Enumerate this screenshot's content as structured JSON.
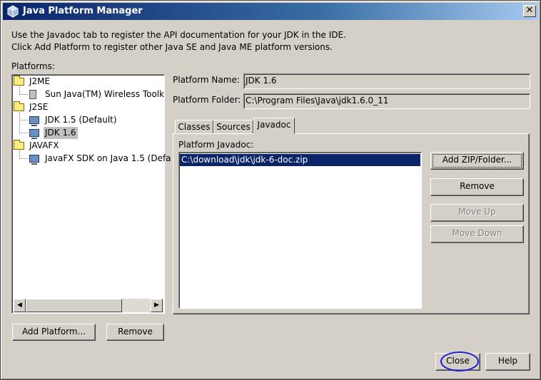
{
  "window": {
    "title": "Java Platform Manager",
    "close_glyph": "✕"
  },
  "intro": {
    "line1": "Use the Javadoc tab to register the API documentation for your JDK in the IDE.",
    "line2": "Click Add Platform to register other Java SE and Java ME platform versions."
  },
  "platforms": {
    "label": "Platforms:",
    "tree": [
      {
        "label": "J2ME",
        "icon": "folder-icon",
        "children": [
          {
            "label": "Sun Java(TM) Wireless Toolk",
            "icon": "phone-icon"
          }
        ]
      },
      {
        "label": "J2SE",
        "icon": "folder-icon",
        "children": [
          {
            "label": "JDK 1.5 (Default)",
            "icon": "platform-icon"
          },
          {
            "label": "JDK 1.6",
            "icon": "platform-icon",
            "selected": true
          }
        ]
      },
      {
        "label": "JAVAFX",
        "icon": "folder-icon",
        "children": [
          {
            "label": "JavaFX SDK on Java 1.5 (Defa",
            "icon": "platform-icon"
          }
        ]
      }
    ],
    "add_button": "Add Platform...",
    "remove_button": "Remove"
  },
  "details": {
    "name_label": "Platform Name:",
    "name_value": "JDK 1.6",
    "folder_label": "Platform Folder:",
    "folder_value": "C:\\Program Files\\Java\\jdk1.6.0_11",
    "tabs": [
      "Classes",
      "Sources",
      "Javadoc"
    ],
    "active_tab": "Javadoc",
    "javadoc": {
      "label": "Platform Javadoc:",
      "items": [
        "C:\\download\\jdk\\jdk-6-doc.zip"
      ],
      "buttons": {
        "add": "Add ZIP/Folder...",
        "remove": "Remove",
        "move_up": "Move Up",
        "move_down": "Move Down"
      }
    }
  },
  "footer": {
    "close_button": "Close",
    "help_button": "Help"
  },
  "scrollbar": {
    "left_arrow": "◀",
    "right_arrow": "▶"
  },
  "colors": {
    "dialog_bg": "#d4d0c8",
    "title_gradient_start": "#0a246a",
    "selection": "#0a246a",
    "annotation_ellipse": "#1a1ad8"
  }
}
